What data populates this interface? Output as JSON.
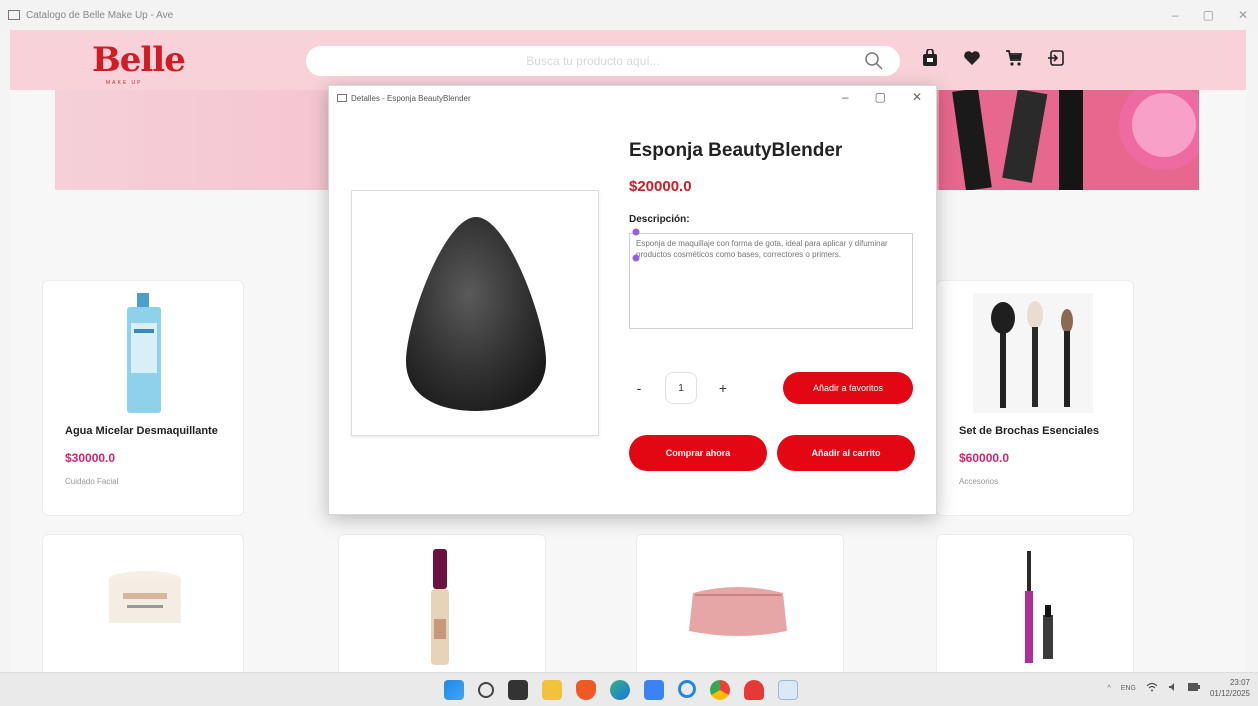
{
  "window": {
    "title": "Catalogo de Belle Make Up - Ave"
  },
  "header": {
    "logo": "Belle",
    "logo_sub": "MAKE UP",
    "search_placeholder": "Busca tu producto aquí..."
  },
  "cards": [
    {
      "name": "Agua Micelar Desmaquillante",
      "price": "$30000.0",
      "category": "Cuidado Facial"
    },
    {
      "name": "Set de Brochas Esenciales",
      "price": "$60000.0",
      "category": "Accesorios"
    }
  ],
  "dialog": {
    "title": "Detalles - Esponja BeautyBlender",
    "product_name": "Esponja BeautyBlender",
    "price": "$20000.0",
    "description_label": "Descripción:",
    "description": "Esponja de maquillaje con forma de gota, ideal para aplicar y difuminar productos cosméticos como bases, correctores o primers.",
    "quantity": "1",
    "minus": "-",
    "plus": "+",
    "favorites_button": "Añadir a favoritos",
    "buy_button": "Comprar ahora",
    "cart_button": "Añadir al carrito"
  },
  "taskbar": {
    "lang": "ENG",
    "time": "23:07",
    "date": "01/12/2025"
  },
  "colors": {
    "brand_red": "#d01c25",
    "button_red": "#e30613",
    "price_pink": "#d6246b",
    "header_pink": "#f9d2d9"
  }
}
